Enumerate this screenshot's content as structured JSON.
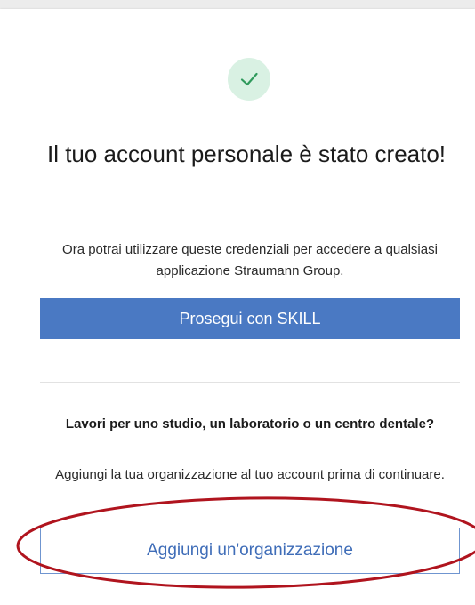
{
  "success": {
    "icon": "check-icon",
    "title": "Il tuo account personale è stato creato!",
    "description": "Ora potrai utilizzare queste credenziali per accedere a qualsiasi applicazione Straumann Group.",
    "continue_label": "Prosegui con SKILL"
  },
  "organization": {
    "question": "Lavori per uno studio, un laboratorio o un centro dentale?",
    "hint": "Aggiungi la tua organizzazione al tuo account prima di continuare.",
    "add_label": "Aggiungi un'organizzazione"
  },
  "colors": {
    "primary": "#4a79c3",
    "success_badge": "#d9f1e3",
    "success_check": "#2f9a5c",
    "annotation_ring": "#b0141e"
  }
}
